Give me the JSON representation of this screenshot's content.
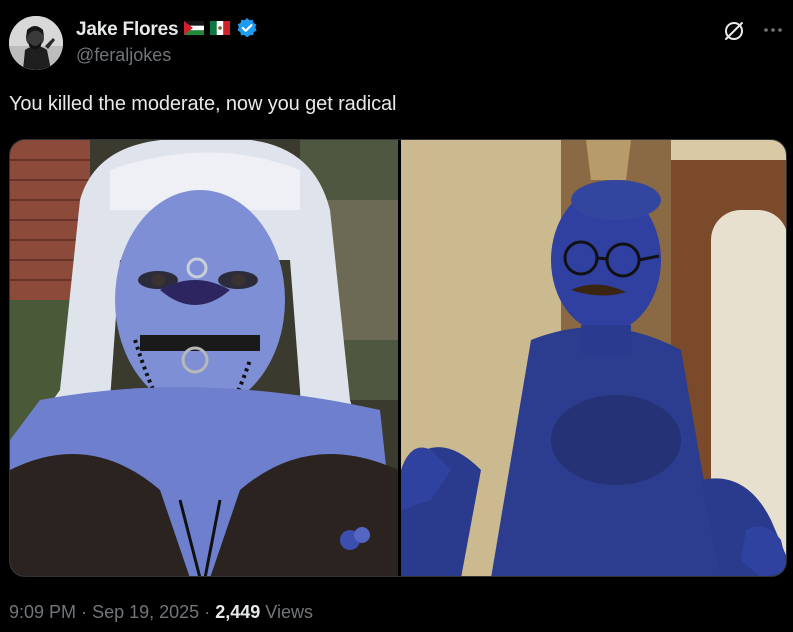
{
  "tweet": {
    "author": {
      "display_name": "Jake Flores",
      "handle": "@feraljokes",
      "flags": [
        "palestine-flag",
        "mexico-flag"
      ],
      "verified": true,
      "avatar": "profile-photo"
    },
    "text": "You killed the moderate, now you get radical",
    "media": [
      {
        "kind": "photo",
        "description_icon": "photo-left"
      },
      {
        "kind": "photo",
        "description_icon": "photo-right"
      }
    ],
    "time": "9:09 PM",
    "separator": "·",
    "date": "Sep 19, 2025",
    "views_count": "2,449",
    "views_label": "Views"
  },
  "icons": {
    "grok": "grok-icon",
    "more": "more-icon"
  },
  "colors": {
    "background": "#000000",
    "text_primary": "#e7e9ea",
    "text_secondary": "#71767b",
    "verified_blue": "#1d9bf0",
    "border": "#2f3336"
  }
}
